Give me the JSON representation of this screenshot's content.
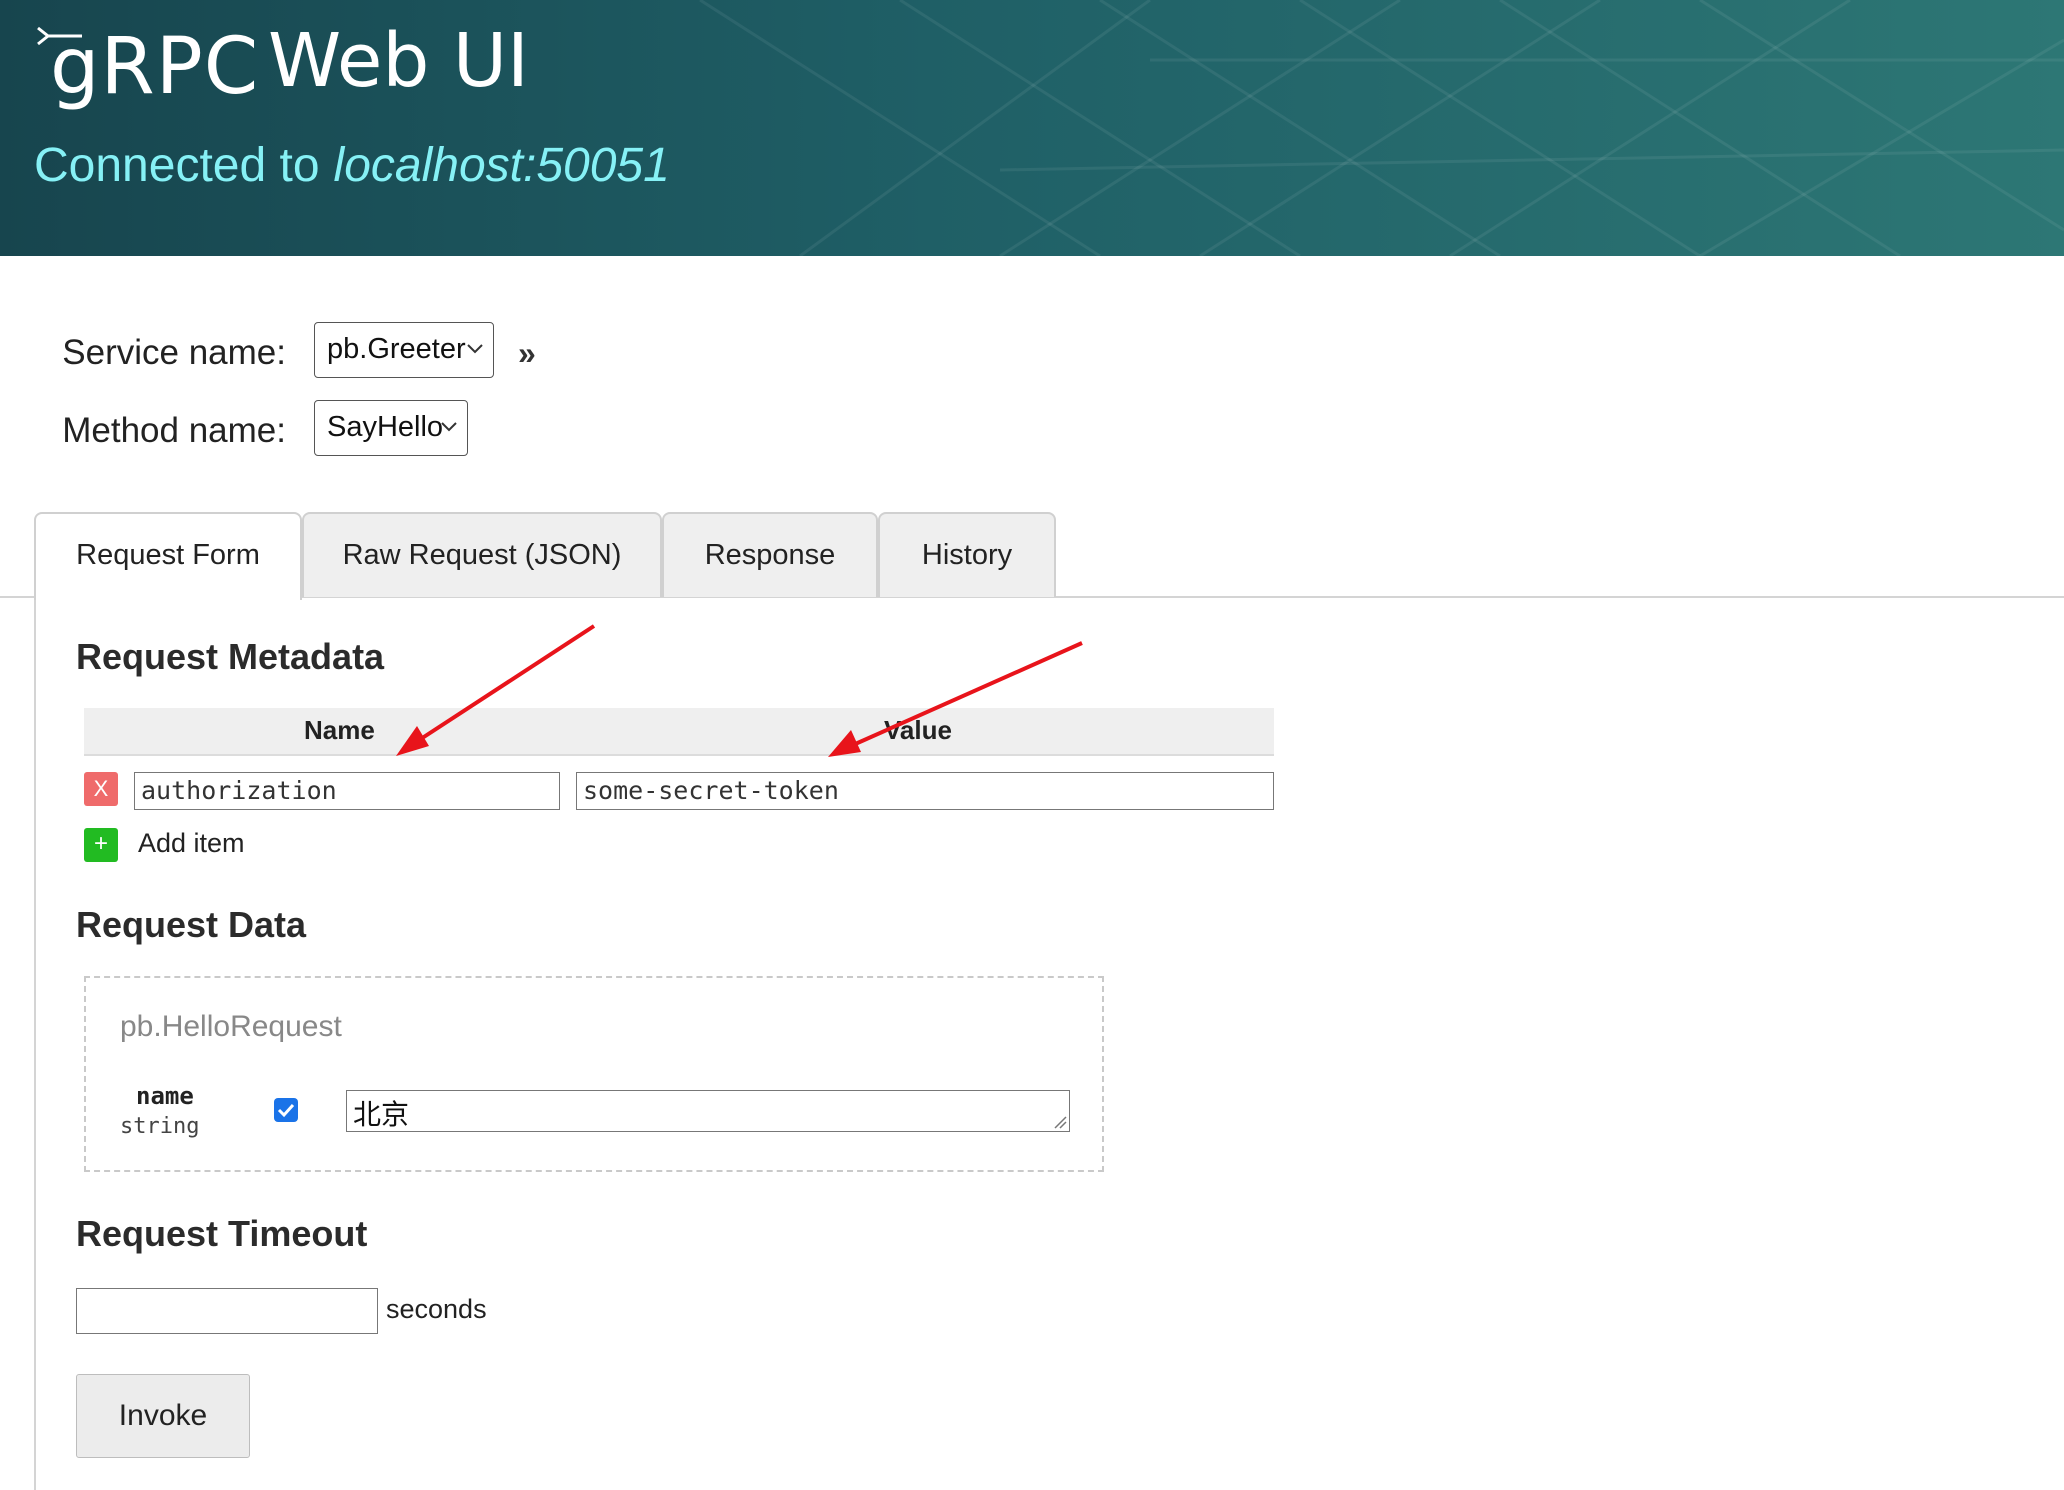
{
  "header": {
    "logo_text": "gRPC",
    "title": "Web UI",
    "connected_label": "Connected to",
    "host": "localhost:50051"
  },
  "selectors": {
    "service_label": "Service name:",
    "service_value": "pb.Greeter",
    "method_label": "Method name:",
    "method_value": "SayHello",
    "expand_glyph": "»"
  },
  "tabs": [
    {
      "label": "Request Form",
      "active": true
    },
    {
      "label": "Raw Request (JSON)",
      "active": false
    },
    {
      "label": "Response",
      "active": false
    },
    {
      "label": "History",
      "active": false
    }
  ],
  "metadata": {
    "heading": "Request Metadata",
    "col_name": "Name",
    "col_value": "Value",
    "rows": [
      {
        "name": "authorization",
        "value": "some-secret-token",
        "remove_label": "X"
      }
    ],
    "add_label": "Add item",
    "add_glyph": "+"
  },
  "request_data": {
    "heading": "Request Data",
    "message_type": "pb.HelloRequest",
    "fields": [
      {
        "name": "name",
        "type": "string",
        "checked": true,
        "value": "北京"
      }
    ]
  },
  "timeout": {
    "heading": "Request Timeout",
    "value": "",
    "unit": "seconds"
  },
  "invoke_label": "Invoke",
  "colors": {
    "header_dark": "#17454e",
    "header_light": "#2d7775",
    "host_text": "#86f1f6",
    "remove_button": "#ef6b6b",
    "add_button": "#22bb22",
    "annotation_arrow": "#e8141b"
  }
}
